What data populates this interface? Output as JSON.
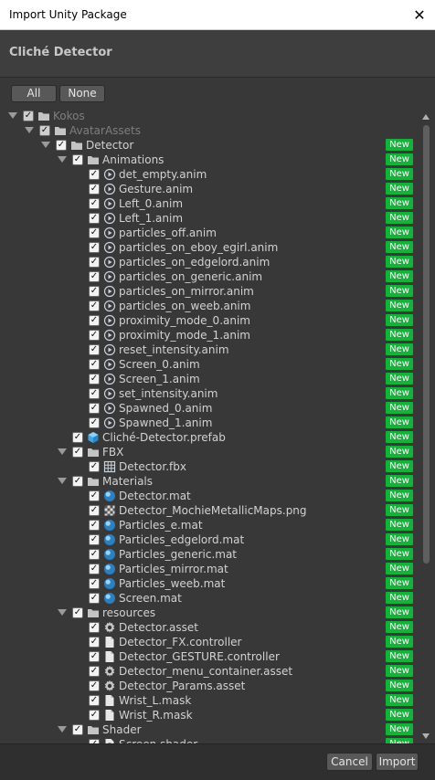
{
  "window": {
    "title": "Import Unity Package",
    "close_glyph": "✕"
  },
  "package": {
    "name": "Cliché Detector"
  },
  "selection": {
    "all_label": "All",
    "none_label": "None"
  },
  "badge": {
    "new_label": "New",
    "color": "#16b13a"
  },
  "footer": {
    "cancel_label": "Cancel",
    "import_label": "Import"
  },
  "tree": [
    {
      "label": "Kokos",
      "depth": 0,
      "icon": "folder-icon",
      "expandable": true,
      "dim": true,
      "new": false
    },
    {
      "label": "AvatarAssets",
      "depth": 1,
      "icon": "folder-icon",
      "expandable": true,
      "dim": true,
      "new": false
    },
    {
      "label": "Detector",
      "depth": 2,
      "icon": "folder-icon",
      "expandable": true,
      "dim": false,
      "new": true
    },
    {
      "label": "Animations",
      "depth": 3,
      "icon": "folder-icon",
      "expandable": true,
      "dim": false,
      "new": true
    },
    {
      "label": "det_empty.anim",
      "depth": 4,
      "icon": "animation-clip-icon",
      "expandable": false,
      "dim": false,
      "new": true
    },
    {
      "label": "Gesture.anim",
      "depth": 4,
      "icon": "animation-clip-icon",
      "expandable": false,
      "dim": false,
      "new": true
    },
    {
      "label": "Left_0.anim",
      "depth": 4,
      "icon": "animation-clip-icon",
      "expandable": false,
      "dim": false,
      "new": true
    },
    {
      "label": "Left_1.anim",
      "depth": 4,
      "icon": "animation-clip-icon",
      "expandable": false,
      "dim": false,
      "new": true
    },
    {
      "label": "particles_off.anim",
      "depth": 4,
      "icon": "animation-clip-icon",
      "expandable": false,
      "dim": false,
      "new": true
    },
    {
      "label": "particles_on_eboy_egirl.anim",
      "depth": 4,
      "icon": "animation-clip-icon",
      "expandable": false,
      "dim": false,
      "new": true
    },
    {
      "label": "particles_on_edgelord.anim",
      "depth": 4,
      "icon": "animation-clip-icon",
      "expandable": false,
      "dim": false,
      "new": true
    },
    {
      "label": "particles_on_generic.anim",
      "depth": 4,
      "icon": "animation-clip-icon",
      "expandable": false,
      "dim": false,
      "new": true
    },
    {
      "label": "particles_on_mirror.anim",
      "depth": 4,
      "icon": "animation-clip-icon",
      "expandable": false,
      "dim": false,
      "new": true
    },
    {
      "label": "particles_on_weeb.anim",
      "depth": 4,
      "icon": "animation-clip-icon",
      "expandable": false,
      "dim": false,
      "new": true
    },
    {
      "label": "proximity_mode_0.anim",
      "depth": 4,
      "icon": "animation-clip-icon",
      "expandable": false,
      "dim": false,
      "new": true
    },
    {
      "label": "proximity_mode_1.anim",
      "depth": 4,
      "icon": "animation-clip-icon",
      "expandable": false,
      "dim": false,
      "new": true
    },
    {
      "label": "reset_intensity.anim",
      "depth": 4,
      "icon": "animation-clip-icon",
      "expandable": false,
      "dim": false,
      "new": true
    },
    {
      "label": "Screen_0.anim",
      "depth": 4,
      "icon": "animation-clip-icon",
      "expandable": false,
      "dim": false,
      "new": true
    },
    {
      "label": "Screen_1.anim",
      "depth": 4,
      "icon": "animation-clip-icon",
      "expandable": false,
      "dim": false,
      "new": true
    },
    {
      "label": "set_intensity.anim",
      "depth": 4,
      "icon": "animation-clip-icon",
      "expandable": false,
      "dim": false,
      "new": true
    },
    {
      "label": "Spawned_0.anim",
      "depth": 4,
      "icon": "animation-clip-icon",
      "expandable": false,
      "dim": false,
      "new": true
    },
    {
      "label": "Spawned_1.anim",
      "depth": 4,
      "icon": "animation-clip-icon",
      "expandable": false,
      "dim": false,
      "new": true
    },
    {
      "label": "Cliché-Detector.prefab",
      "depth": 3,
      "icon": "prefab-icon",
      "expandable": false,
      "dim": false,
      "new": true
    },
    {
      "label": "FBX",
      "depth": 3,
      "icon": "folder-icon",
      "expandable": true,
      "dim": false,
      "new": true
    },
    {
      "label": "Detector.fbx",
      "depth": 4,
      "icon": "mesh-grid-icon",
      "expandable": false,
      "dim": false,
      "new": true
    },
    {
      "label": "Materials",
      "depth": 3,
      "icon": "folder-icon",
      "expandable": true,
      "dim": false,
      "new": true
    },
    {
      "label": "Detector.mat",
      "depth": 4,
      "icon": "material-sphere-icon",
      "expandable": false,
      "dim": false,
      "new": true
    },
    {
      "label": "Detector_MochieMetallicMaps.png",
      "depth": 4,
      "icon": "texture-icon",
      "expandable": false,
      "dim": false,
      "new": true
    },
    {
      "label": "Particles_e.mat",
      "depth": 4,
      "icon": "material-sphere-icon",
      "expandable": false,
      "dim": false,
      "new": true
    },
    {
      "label": "Particles_edgelord.mat",
      "depth": 4,
      "icon": "material-sphere-icon",
      "expandable": false,
      "dim": false,
      "new": true
    },
    {
      "label": "Particles_generic.mat",
      "depth": 4,
      "icon": "material-sphere-icon",
      "expandable": false,
      "dim": false,
      "new": true
    },
    {
      "label": "Particles_mirror.mat",
      "depth": 4,
      "icon": "material-sphere-icon",
      "expandable": false,
      "dim": false,
      "new": true
    },
    {
      "label": "Particles_weeb.mat",
      "depth": 4,
      "icon": "material-sphere-icon",
      "expandable": false,
      "dim": false,
      "new": true
    },
    {
      "label": "Screen.mat",
      "depth": 4,
      "icon": "material-sphere-icon",
      "expandable": false,
      "dim": false,
      "new": true
    },
    {
      "label": "resources",
      "depth": 3,
      "icon": "folder-icon",
      "expandable": true,
      "dim": false,
      "new": true
    },
    {
      "label": "Detector.asset",
      "depth": 4,
      "icon": "gear-icon",
      "expandable": false,
      "dim": false,
      "new": true
    },
    {
      "label": "Detector_FX.controller",
      "depth": 4,
      "icon": "file-icon",
      "expandable": false,
      "dim": false,
      "new": true
    },
    {
      "label": "Detector_GESTURE.controller",
      "depth": 4,
      "icon": "file-icon",
      "expandable": false,
      "dim": false,
      "new": true
    },
    {
      "label": "Detector_menu_container.asset",
      "depth": 4,
      "icon": "gear-icon",
      "expandable": false,
      "dim": false,
      "new": true
    },
    {
      "label": "Detector_Params.asset",
      "depth": 4,
      "icon": "gear-icon",
      "expandable": false,
      "dim": false,
      "new": true
    },
    {
      "label": "Wrist_L.mask",
      "depth": 4,
      "icon": "file-icon",
      "expandable": false,
      "dim": false,
      "new": true
    },
    {
      "label": "Wrist_R.mask",
      "depth": 4,
      "icon": "file-icon",
      "expandable": false,
      "dim": false,
      "new": true
    },
    {
      "label": "Shader",
      "depth": 3,
      "icon": "folder-icon",
      "expandable": true,
      "dim": false,
      "new": true
    },
    {
      "label": "Screen.shader",
      "depth": 4,
      "icon": "shader-icon",
      "expandable": false,
      "dim": false,
      "new": true
    }
  ]
}
